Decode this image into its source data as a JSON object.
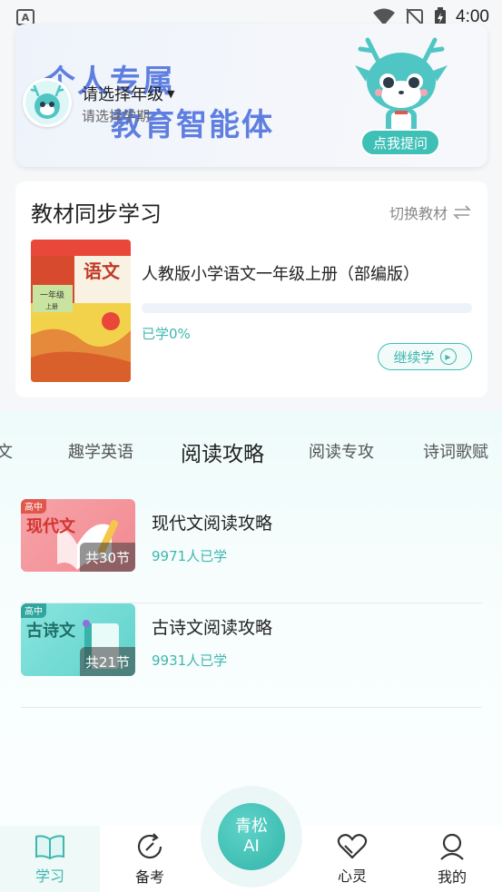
{
  "status_bar": {
    "time": "4:00",
    "left_badge": "A"
  },
  "hero": {
    "slogan_line1": "个人专属",
    "slogan_line2": "教育智能体",
    "grade_title": "请选择年级",
    "grade_subtitle": "请选择学期",
    "ask_button": "点我提问"
  },
  "textbook": {
    "title": "教材同步学习",
    "switch_label": "切换教材",
    "cover_title": "语文",
    "cover_grade": "一年级",
    "cover_term": "上册",
    "book_name": "人教版小学语文一年级上册（部编版）",
    "progress": 0,
    "progress_text": "已学0%",
    "continue_label": "继续学"
  },
  "tabs": [
    "文",
    "趣学英语",
    "阅读攻略",
    "阅读专攻",
    "诗词歌赋"
  ],
  "active_tab": "阅读攻略",
  "courses": [
    {
      "badge": "高中",
      "cover_text": "现代文",
      "count": "共30节",
      "title": "现代文阅读攻略",
      "learners": "9971人已学"
    },
    {
      "badge": "高中",
      "cover_text": "古诗文",
      "count": "共21节",
      "title": "古诗文阅读攻略",
      "learners": "9931人已学"
    }
  ],
  "bottom_nav": {
    "items": [
      "学习",
      "备考",
      "心灵",
      "我的"
    ],
    "ai_line1": "青松",
    "ai_line2": "AI"
  },
  "colors": {
    "accent": "#3fc0b6",
    "slogan": "#5f7fe0"
  }
}
